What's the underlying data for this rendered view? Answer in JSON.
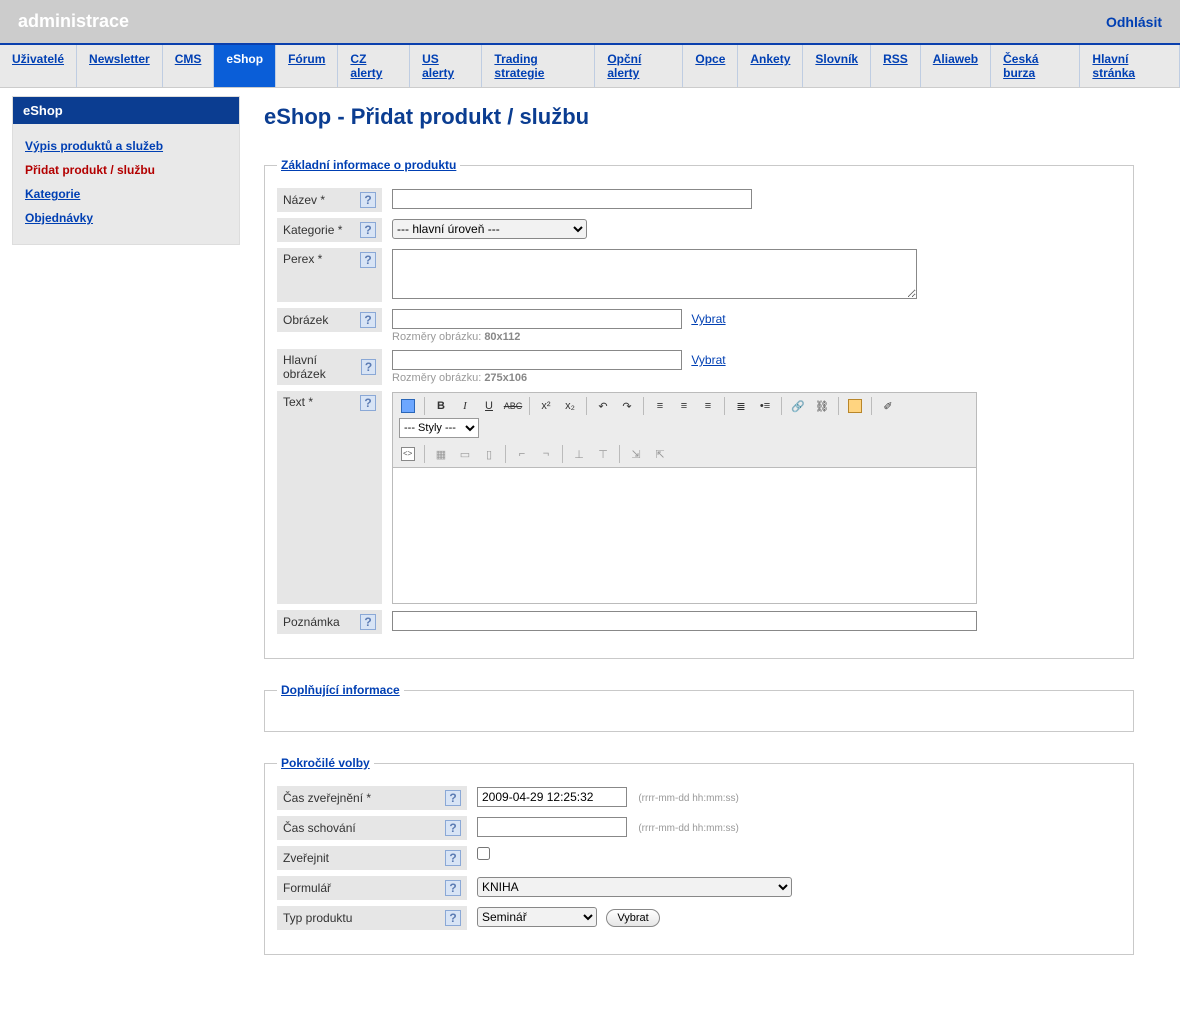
{
  "header": {
    "title": "administrace",
    "logout": "Odhlásit"
  },
  "topnav": {
    "items": [
      {
        "label": "Uživatelé"
      },
      {
        "label": "Newsletter"
      },
      {
        "label": "CMS"
      },
      {
        "label": "eShop",
        "active": true
      },
      {
        "label": "Fórum"
      },
      {
        "label": "CZ alerty"
      },
      {
        "label": "US alerty"
      },
      {
        "label": "Trading strategie"
      },
      {
        "label": "Opční alerty"
      },
      {
        "label": "Opce"
      },
      {
        "label": "Ankety"
      },
      {
        "label": "Slovník"
      },
      {
        "label": "RSS"
      },
      {
        "label": "Aliaweb"
      },
      {
        "label": "Česká burza"
      },
      {
        "label": "Hlavní stránka"
      }
    ]
  },
  "sidebar": {
    "title": "eShop",
    "items": [
      {
        "label": "Výpis produktů a služeb"
      },
      {
        "label": "Přidat produkt / službu",
        "active": true
      },
      {
        "label": "Kategorie"
      },
      {
        "label": "Objednávky"
      }
    ]
  },
  "page": {
    "title": "eShop - Přidat produkt / službu"
  },
  "section_basic": {
    "legend": "Základní informace o produktu",
    "name_label": "Název *",
    "category_label": "Kategorie *",
    "category_selected": "--- hlavní úroveň ---",
    "perex_label": "Perex *",
    "image_label": "Obrázek",
    "image_select": "Vybrat",
    "image_hint_prefix": "Rozměry obrázku: ",
    "image_hint_value": "80x112",
    "mainimage_label": "Hlavní obrázek",
    "mainimage_select": "Vybrat",
    "mainimage_hint_prefix": "Rozměry obrázku: ",
    "mainimage_hint_value": "275x106",
    "text_label": "Text *",
    "note_label": "Poznámka",
    "editor_style": "--- Styly ---"
  },
  "section_extra": {
    "legend": "Doplňující informace"
  },
  "section_adv": {
    "legend": "Pokročilé volby",
    "publish_time_label": "Čas zveřejnění *",
    "publish_time_value": "2009-04-29 12:25:32",
    "hide_time_label": "Čas schování",
    "hide_time_value": "",
    "date_format": "(rrrr-mm-dd hh:mm:ss)",
    "publish_label": "Zveřejnit",
    "form_label": "Formulář",
    "form_selected": "KNIHA",
    "type_label": "Typ produktu",
    "type_selected": "Seminář",
    "type_button": "Vybrat"
  },
  "help_symbol": "?"
}
